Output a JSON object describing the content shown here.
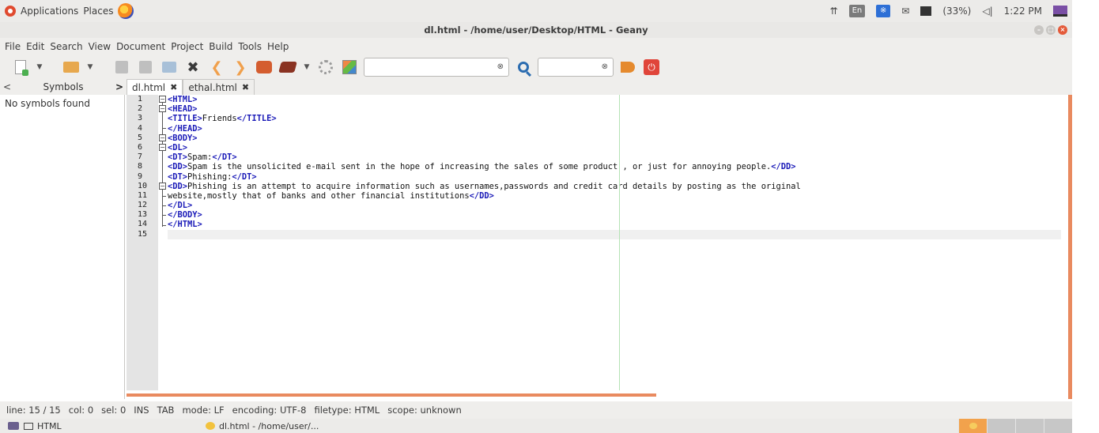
{
  "top_panel": {
    "menu_applications": "Applications",
    "menu_places": "Places",
    "tray": {
      "keyboard_layout": "En",
      "battery": "(33%)",
      "clock": "1:22 PM"
    }
  },
  "window": {
    "title": "dl.html - /home/user/Desktop/HTML - Geany"
  },
  "menu": [
    "File",
    "Edit",
    "Search",
    "View",
    "Document",
    "Project",
    "Build",
    "Tools",
    "Help"
  ],
  "toolbar": {
    "search_value": "",
    "goto_value": ""
  },
  "sidebar": {
    "tab_label": "Symbols",
    "empty_message": "No symbols found"
  },
  "tabs": [
    {
      "label": "dl.html",
      "active": true
    },
    {
      "label": "ethal.html",
      "active": false
    }
  ],
  "editor": {
    "line_numbers": [
      "1",
      "2",
      "3",
      "4",
      "5",
      "6",
      "7",
      "8",
      "9",
      "10",
      "11",
      "12",
      "13",
      "14",
      "15"
    ],
    "lines": [
      [
        {
          "t": "<HTML>",
          "tag": true
        }
      ],
      [
        {
          "t": "<HEAD>",
          "tag": true
        }
      ],
      [
        {
          "t": "<TITLE>",
          "tag": true
        },
        {
          "t": "Friends"
        },
        {
          "t": "</TITLE>",
          "tag": true
        }
      ],
      [
        {
          "t": "</HEAD>",
          "tag": true
        }
      ],
      [
        {
          "t": "<BODY>",
          "tag": true
        }
      ],
      [
        {
          "t": "<DL>",
          "tag": true
        }
      ],
      [
        {
          "t": "<DT>",
          "tag": true
        },
        {
          "t": "Spam:"
        },
        {
          "t": "</DT>",
          "tag": true
        }
      ],
      [
        {
          "t": "<DD>",
          "tag": true
        },
        {
          "t": "Spam is the unsolicited e-mail sent in the hope of increasing the sales of some product , or just for annoying people."
        },
        {
          "t": "</DD>",
          "tag": true
        }
      ],
      [
        {
          "t": "<DT>",
          "tag": true
        },
        {
          "t": "Phishing:"
        },
        {
          "t": "</DT>",
          "tag": true
        }
      ],
      [
        {
          "t": "<DD>",
          "tag": true
        },
        {
          "t": "Phishing is an attempt to acquire information such as usernames,passwords and credit card details by posting as the original"
        }
      ],
      [
        {
          "t": "website,mostly that of banks and other financial institutions"
        },
        {
          "t": "</DD>",
          "tag": true
        }
      ],
      [
        {
          "t": "</DL>",
          "tag": true
        }
      ],
      [
        {
          "t": "</BODY>",
          "tag": true
        }
      ],
      [
        {
          "t": "</HTML>",
          "tag": true
        }
      ],
      []
    ]
  },
  "status": {
    "line": "line: 15 / 15",
    "col": "col: 0",
    "sel": "sel: 0",
    "ins": "INS",
    "tab": "TAB",
    "mode": "mode: LF",
    "encoding": "encoding: UTF-8",
    "filetype": "filetype: HTML",
    "scope": "scope: unknown"
  },
  "taskbar": {
    "items": [
      "HTML",
      "dl.html - /home/user/..."
    ]
  },
  "colors": {
    "tag": "#1a1ab8",
    "accent": "#e98a5f"
  }
}
